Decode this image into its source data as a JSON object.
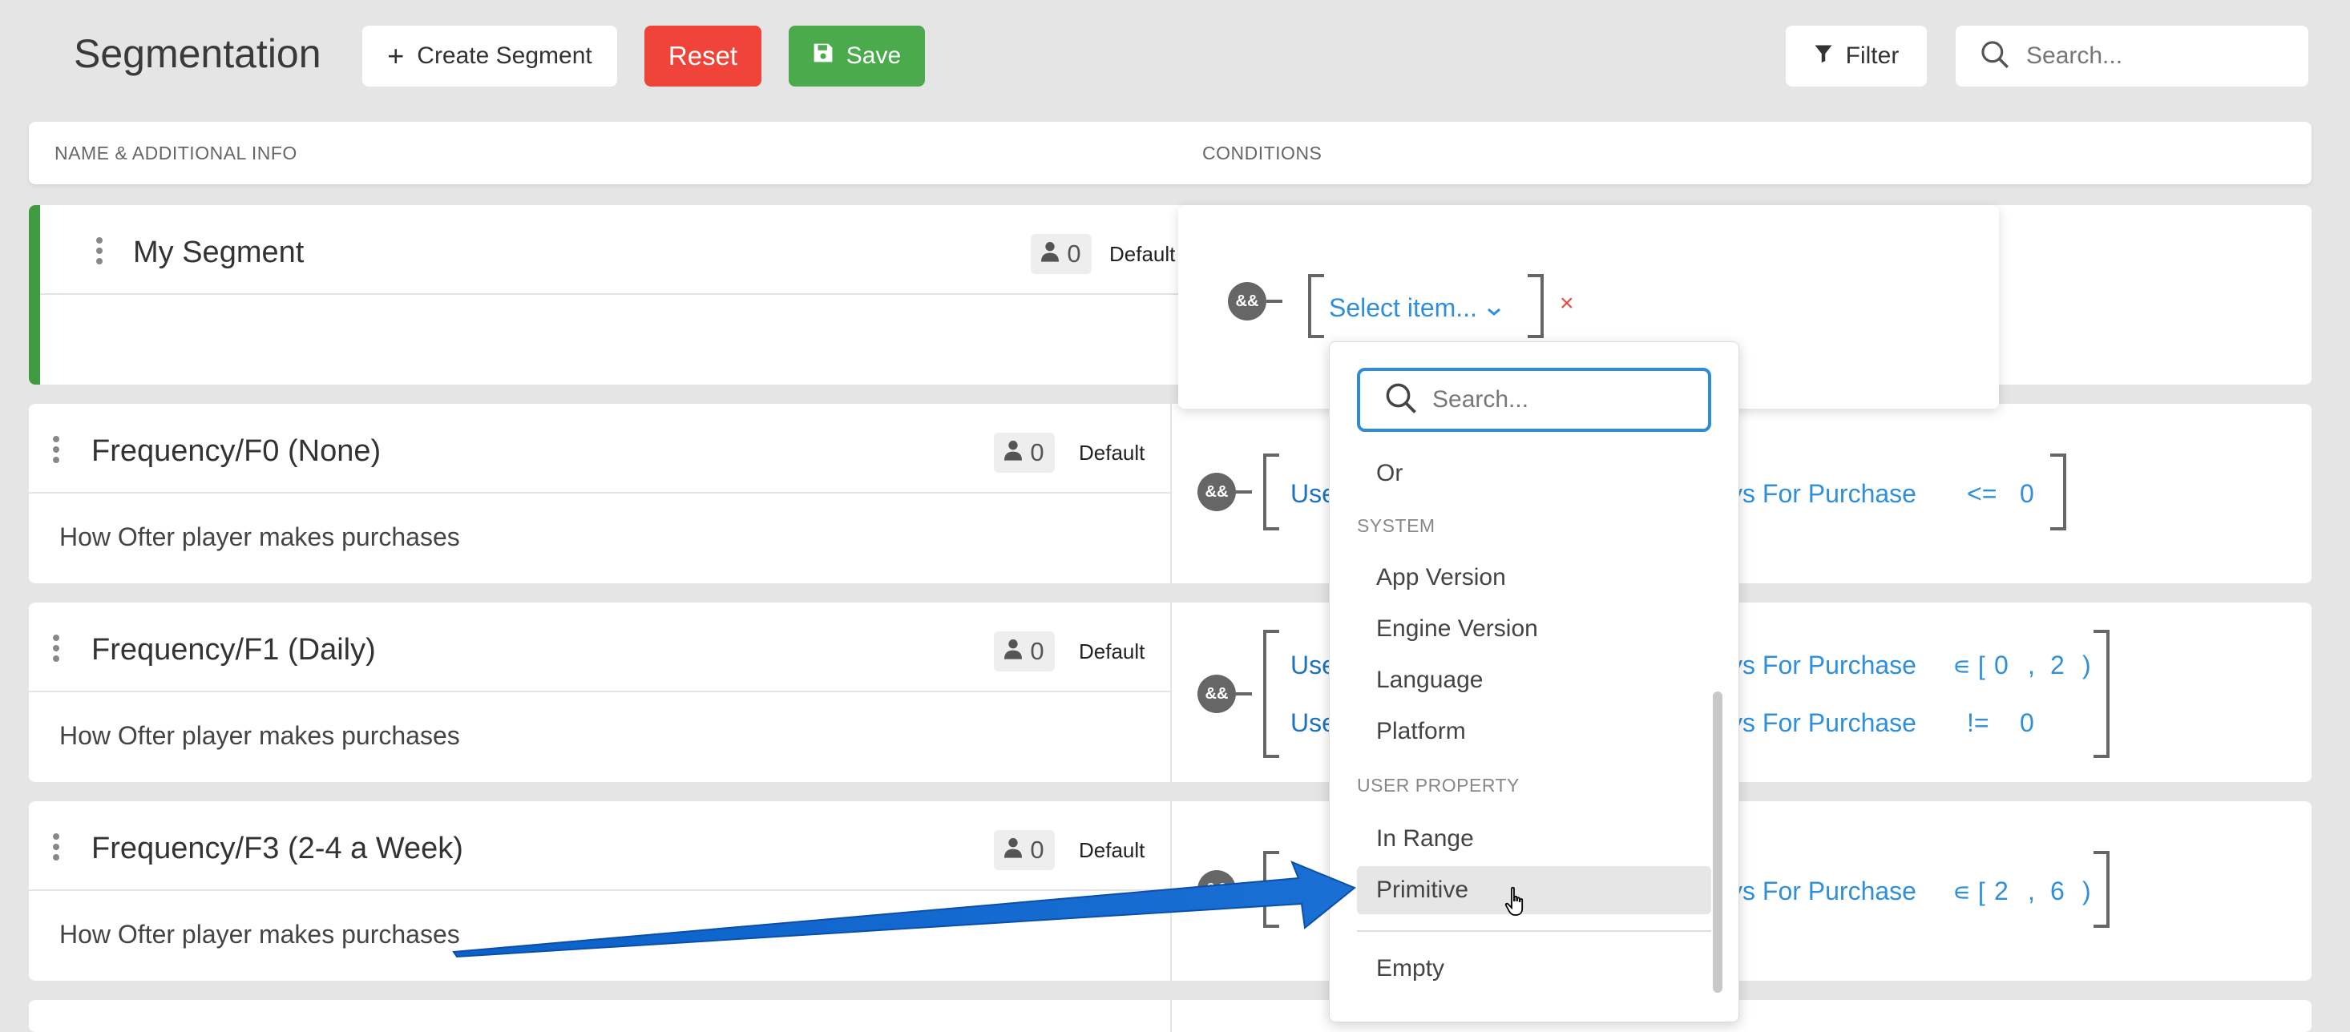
{
  "header": {
    "title": "Segmentation",
    "create_label": "Create Segment",
    "reset_label": "Reset",
    "save_label": "Save",
    "filter_label": "Filter",
    "search_placeholder": "Search..."
  },
  "table": {
    "col_name": "NAME & ADDITIONAL INFO",
    "col_conditions": "CONDITIONS"
  },
  "rows": [
    {
      "name": "My Segment",
      "count": "0",
      "tag": "Default",
      "description": "",
      "editor": {
        "operator": "&&",
        "select_label": "Select item...",
        "remove": "×"
      }
    },
    {
      "name": "Frequency/F0 (None)",
      "count": "0",
      "tag": "Default",
      "description": "How Ofter player makes purchases",
      "operator": "&&",
      "conditions": [
        {
          "left": "Use",
          "field": "ys For Purchase",
          "op": "<=",
          "value": "0"
        }
      ]
    },
    {
      "name": "Frequency/F1 (Daily)",
      "count": "0",
      "tag": "Default",
      "description": "How Ofter player makes purchases",
      "operator": "&&",
      "conditions": [
        {
          "left": "Use",
          "field": "ys For Purchase",
          "op": "∊ [",
          "value": "0",
          "sep": ",",
          "value2": "2",
          "close": ")"
        },
        {
          "left": "Use",
          "field": "ys For Purchase",
          "op": "!=",
          "value": "0"
        }
      ]
    },
    {
      "name": "Frequency/F3 (2-4 a Week)",
      "count": "0",
      "tag": "Default",
      "description": "How Ofter player makes purchases",
      "operator": "&&",
      "conditions": [
        {
          "field": "ys For Purchase",
          "op": "∊ [",
          "value": "2",
          "sep": ",",
          "value2": "6",
          "close": ")"
        }
      ]
    }
  ],
  "dropdown": {
    "search_placeholder": "Search...",
    "top_item": "Or",
    "groups": [
      {
        "label": "SYSTEM",
        "items": [
          "App Version",
          "Engine Version",
          "Language",
          "Platform"
        ]
      },
      {
        "label": "USER PROPERTY",
        "items": [
          "In Range",
          "Primitive"
        ]
      }
    ],
    "bottom_item": "Empty",
    "hovered_item": "Primitive"
  },
  "colors": {
    "reset": "#f0443a",
    "save": "#4aaa4c",
    "selected_row_accent": "#3e9b3f",
    "link_blue": "#2f8fdc",
    "annotation_arrow": "#0a5fc4"
  }
}
